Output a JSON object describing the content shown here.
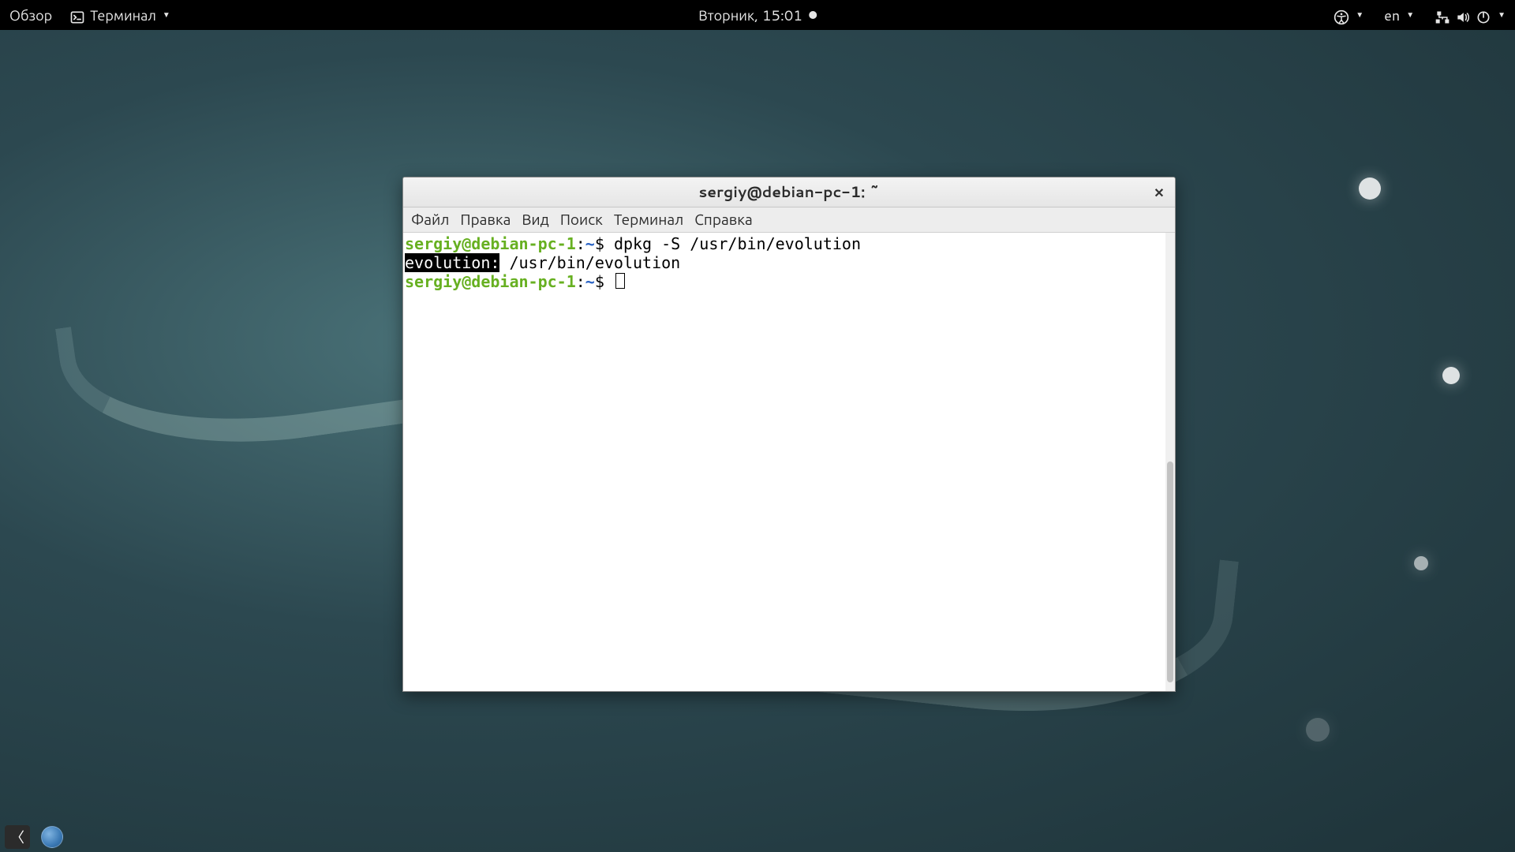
{
  "top_panel": {
    "activities_label": "Обзор",
    "active_app_label": "Терминал",
    "clock": "Вторник, 15:01",
    "input_method": "en"
  },
  "terminal": {
    "window_title": "sergiy@debian-pc-1: ~",
    "menus": {
      "file": "Файл",
      "edit": "Правка",
      "view": "Вид",
      "search": "Поиск",
      "terminal": "Терминал",
      "help": "Справка"
    },
    "prompt": {
      "user_host": "sergiy@debian-pc-1",
      "sep": ":",
      "path": "~",
      "symbol": "$"
    },
    "session": {
      "command": "dpkg -S /usr/bin/evolution",
      "output_pkg": "evolution:",
      "output_path": " /usr/bin/evolution"
    }
  }
}
